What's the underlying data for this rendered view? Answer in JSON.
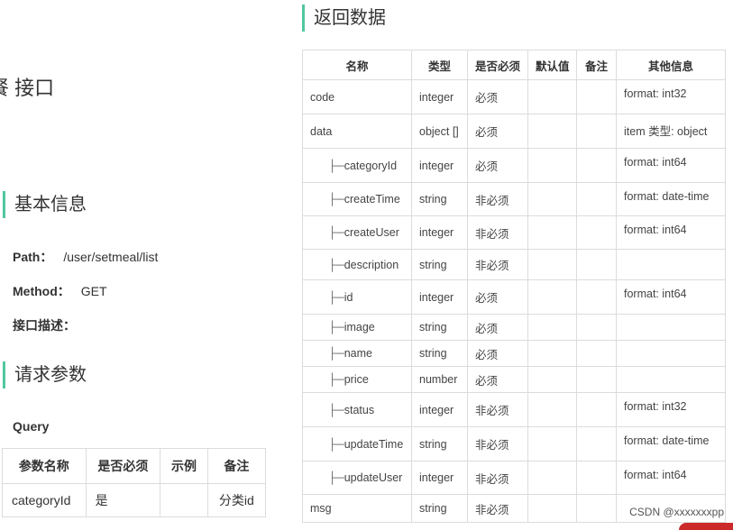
{
  "page": {
    "api_title": "餐 接口",
    "basic_section": "基本信息",
    "path_label": "Path：",
    "path_value": "/user/setmeal/list",
    "method_label": "Method：",
    "method_value": "GET",
    "desc_label": "接口描述：",
    "request_section": "请求参数",
    "query_label": "Query",
    "response_section": "返回数据",
    "watermark": "CSDN @xxxxxxxpp"
  },
  "params": {
    "headers": [
      "参数名称",
      "是否必须",
      "示例",
      "备注"
    ],
    "rows": [
      {
        "name": "categoryId",
        "required": "是",
        "example": "",
        "remark": "分类id"
      }
    ]
  },
  "response": {
    "headers": [
      "名称",
      "类型",
      "是否必须",
      "默认值",
      "备注",
      "其他信息"
    ],
    "tree_prefix": "├─",
    "rows": [
      {
        "name": "code",
        "type": "integer",
        "required": "必须",
        "default": "",
        "remark": "",
        "info": "format: int32"
      },
      {
        "name": "data",
        "type": "object []",
        "required": "必须",
        "default": "",
        "remark": "",
        "info": "item 类型: object"
      },
      {
        "name": "categoryId",
        "type": "integer",
        "required": "必须",
        "default": "",
        "remark": "",
        "info": "format: int64"
      },
      {
        "name": "createTime",
        "type": "string",
        "required": "非必须",
        "default": "",
        "remark": "",
        "info": "format: date-time"
      },
      {
        "name": "createUser",
        "type": "integer",
        "required": "非必须",
        "default": "",
        "remark": "",
        "info": "format: int64"
      },
      {
        "name": "description",
        "type": "string",
        "required": "非必须",
        "default": "",
        "remark": "",
        "info": ""
      },
      {
        "name": "id",
        "type": "integer",
        "required": "必须",
        "default": "",
        "remark": "",
        "info": "format: int64"
      },
      {
        "name": "image",
        "type": "string",
        "required": "必须",
        "default": "",
        "remark": "",
        "info": ""
      },
      {
        "name": "name",
        "type": "string",
        "required": "必须",
        "default": "",
        "remark": "",
        "info": ""
      },
      {
        "name": "price",
        "type": "number",
        "required": "必须",
        "default": "",
        "remark": "",
        "info": ""
      },
      {
        "name": "status",
        "type": "integer",
        "required": "非必须",
        "default": "",
        "remark": "",
        "info": "format: int32"
      },
      {
        "name": "updateTime",
        "type": "string",
        "required": "非必须",
        "default": "",
        "remark": "",
        "info": "format: date-time"
      },
      {
        "name": "updateUser",
        "type": "integer",
        "required": "非必须",
        "default": "",
        "remark": "",
        "info": "format: int64"
      },
      {
        "name": "msg",
        "type": "string",
        "required": "非必须",
        "default": "",
        "remark": "",
        "info": ""
      }
    ]
  }
}
